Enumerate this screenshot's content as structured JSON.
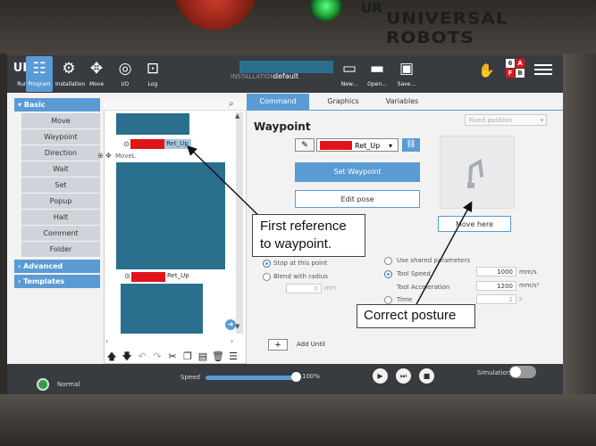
{
  "hardware": {
    "brand_logo_mark": "UR",
    "brand_name": "UNIVERSAL ROBOTS"
  },
  "header": {
    "tabs": [
      {
        "label": "Run",
        "icon": "run-icon"
      },
      {
        "label": "Program",
        "icon": "program-icon"
      },
      {
        "label": "Installation",
        "icon": "installation-icon"
      },
      {
        "label": "Move",
        "icon": "move-icon"
      },
      {
        "label": "I/O",
        "icon": "io-icon"
      },
      {
        "label": "Log",
        "icon": "log-icon"
      }
    ],
    "installation_label": "INSTALLATION",
    "installation_value": "default",
    "file_buttons": [
      {
        "label": "New...",
        "icon": "new-file-icon"
      },
      {
        "label": "Open...",
        "icon": "open-folder-icon"
      },
      {
        "label": "Save...",
        "icon": "save-icon"
      }
    ],
    "speed_grid": [
      "6",
      "A",
      "F",
      "B"
    ],
    "accent": "#5b9bd5"
  },
  "nav": {
    "basic_label": "Basic",
    "items": [
      "Move",
      "Waypoint",
      "Direction",
      "Wait",
      "Set",
      "Popup",
      "Halt",
      "Comment",
      "Folder"
    ],
    "advanced_label": "Advanced",
    "templates_label": "Templates"
  },
  "tree": {
    "wp_name_1": "Ret_Up",
    "movel_label": "MoveL",
    "wp_name_2": "Ret_Up"
  },
  "command": {
    "tabs": [
      "Command",
      "Graphics",
      "Variables"
    ],
    "title": "Waypoint",
    "fixed_position": "Fixed position",
    "waypoint_name": "Ret_Up",
    "set_waypoint": "Set Waypoint",
    "edit_pose": "Edit pose",
    "move_here": "Move here",
    "stop_at_point": "Stop at this point",
    "blend_with_radius": "Blend with radius",
    "blend_value": "0",
    "blend_unit": "mm",
    "use_shared": "Use shared parameters",
    "tool_speed_label": "Tool Speed",
    "tool_speed_value": "1000",
    "tool_speed_unit": "mm/s",
    "tool_accel_label": "Tool Acceleration",
    "tool_accel_value": "1200",
    "tool_accel_unit": "mm/s²",
    "time_label": "Time",
    "time_value": "2",
    "time_unit": "s",
    "add_until": "Add Until"
  },
  "footer": {
    "status": "Normal",
    "speed_label": "Speed",
    "speed_value": "100%",
    "speed_fraction": 1.0,
    "simulation_label": "Simulation"
  },
  "annotations": {
    "first_reference": "First reference to waypoint.",
    "correct_posture": "Correct posture"
  }
}
